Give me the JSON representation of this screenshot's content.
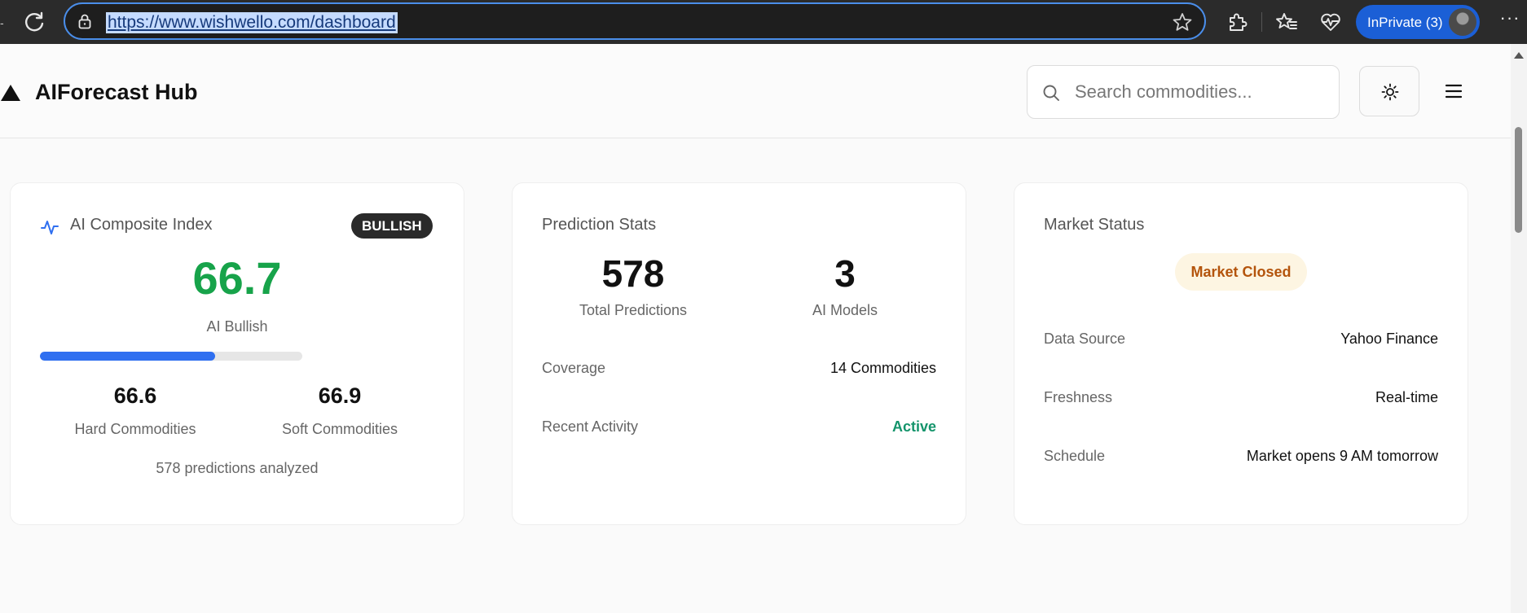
{
  "browser": {
    "url": "https://www.wishwello.com/dashboard",
    "inprivate_label": "InPrivate (3)"
  },
  "header": {
    "app_title": "AIForecast Hub",
    "search_placeholder": "Search commodities..."
  },
  "composite": {
    "title": "AI Composite Index",
    "badge": "BULLISH",
    "value": "66.7",
    "caption": "AI Bullish",
    "progress_fraction": 0.667,
    "hard_value": "66.6",
    "hard_label": "Hard Commodities",
    "soft_value": "66.9",
    "soft_label": "Soft Commodities",
    "footnote": "578 predictions analyzed"
  },
  "prediction_stats": {
    "title": "Prediction Stats",
    "total_value": "578",
    "total_label": "Total Predictions",
    "models_value": "3",
    "models_label": "AI Models",
    "coverage_label": "Coverage",
    "coverage_value": "14 Commodities",
    "activity_label": "Recent Activity",
    "activity_value": "Active"
  },
  "market_status": {
    "title": "Market Status",
    "status_pill": "Market Closed",
    "source_label": "Data Source",
    "source_value": "Yahoo Finance",
    "freshness_label": "Freshness",
    "freshness_value": "Real-time",
    "schedule_label": "Schedule",
    "schedule_value": "Market opens 9 AM tomorrow"
  },
  "colors": {
    "accent_blue": "#2f6ff0",
    "bullish_green": "#17a34a",
    "active_green": "#14946b",
    "closed_orange": "#b4540c",
    "browser_frame": "#2b2b2b",
    "inprivate_blue": "#1b5fd6"
  },
  "icons": {
    "reload": "reload-icon",
    "lock": "lock-icon",
    "favorite": "star-icon",
    "extensions": "puzzle-icon",
    "favorites": "favorites-icon",
    "health": "heart-pulse-icon",
    "more": "more-icon",
    "logo": "triangle-logo-icon",
    "search": "search-icon",
    "theme": "sun-icon",
    "menu": "hamburger-icon",
    "composite": "pulse-icon"
  }
}
